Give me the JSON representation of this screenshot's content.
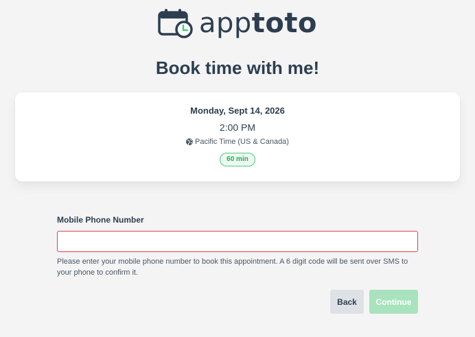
{
  "brand": {
    "name_light": "app",
    "name_bold": "toto",
    "color": "#2d3e50",
    "icon": "calendar-clock-icon"
  },
  "page": {
    "title": "Book time with me!"
  },
  "appointment": {
    "date": "Monday, Sept 14, 2026",
    "time": "2:00 PM",
    "timezone": "Pacific Time (US & Canada)",
    "timezone_icon": "globe-icon",
    "duration": "60 min",
    "duration_color": "#2aa85a"
  },
  "form": {
    "phone_label": "Mobile Phone Number",
    "phone_value": "",
    "phone_error_color": "#d9444a",
    "help_text": "Please enter your mobile phone number to book this appointment. A 6 digit code will be sent over SMS to your phone to confirm it."
  },
  "actions": {
    "back_label": "Back",
    "continue_label": "Continue",
    "continue_color": "#a8e3bd"
  }
}
